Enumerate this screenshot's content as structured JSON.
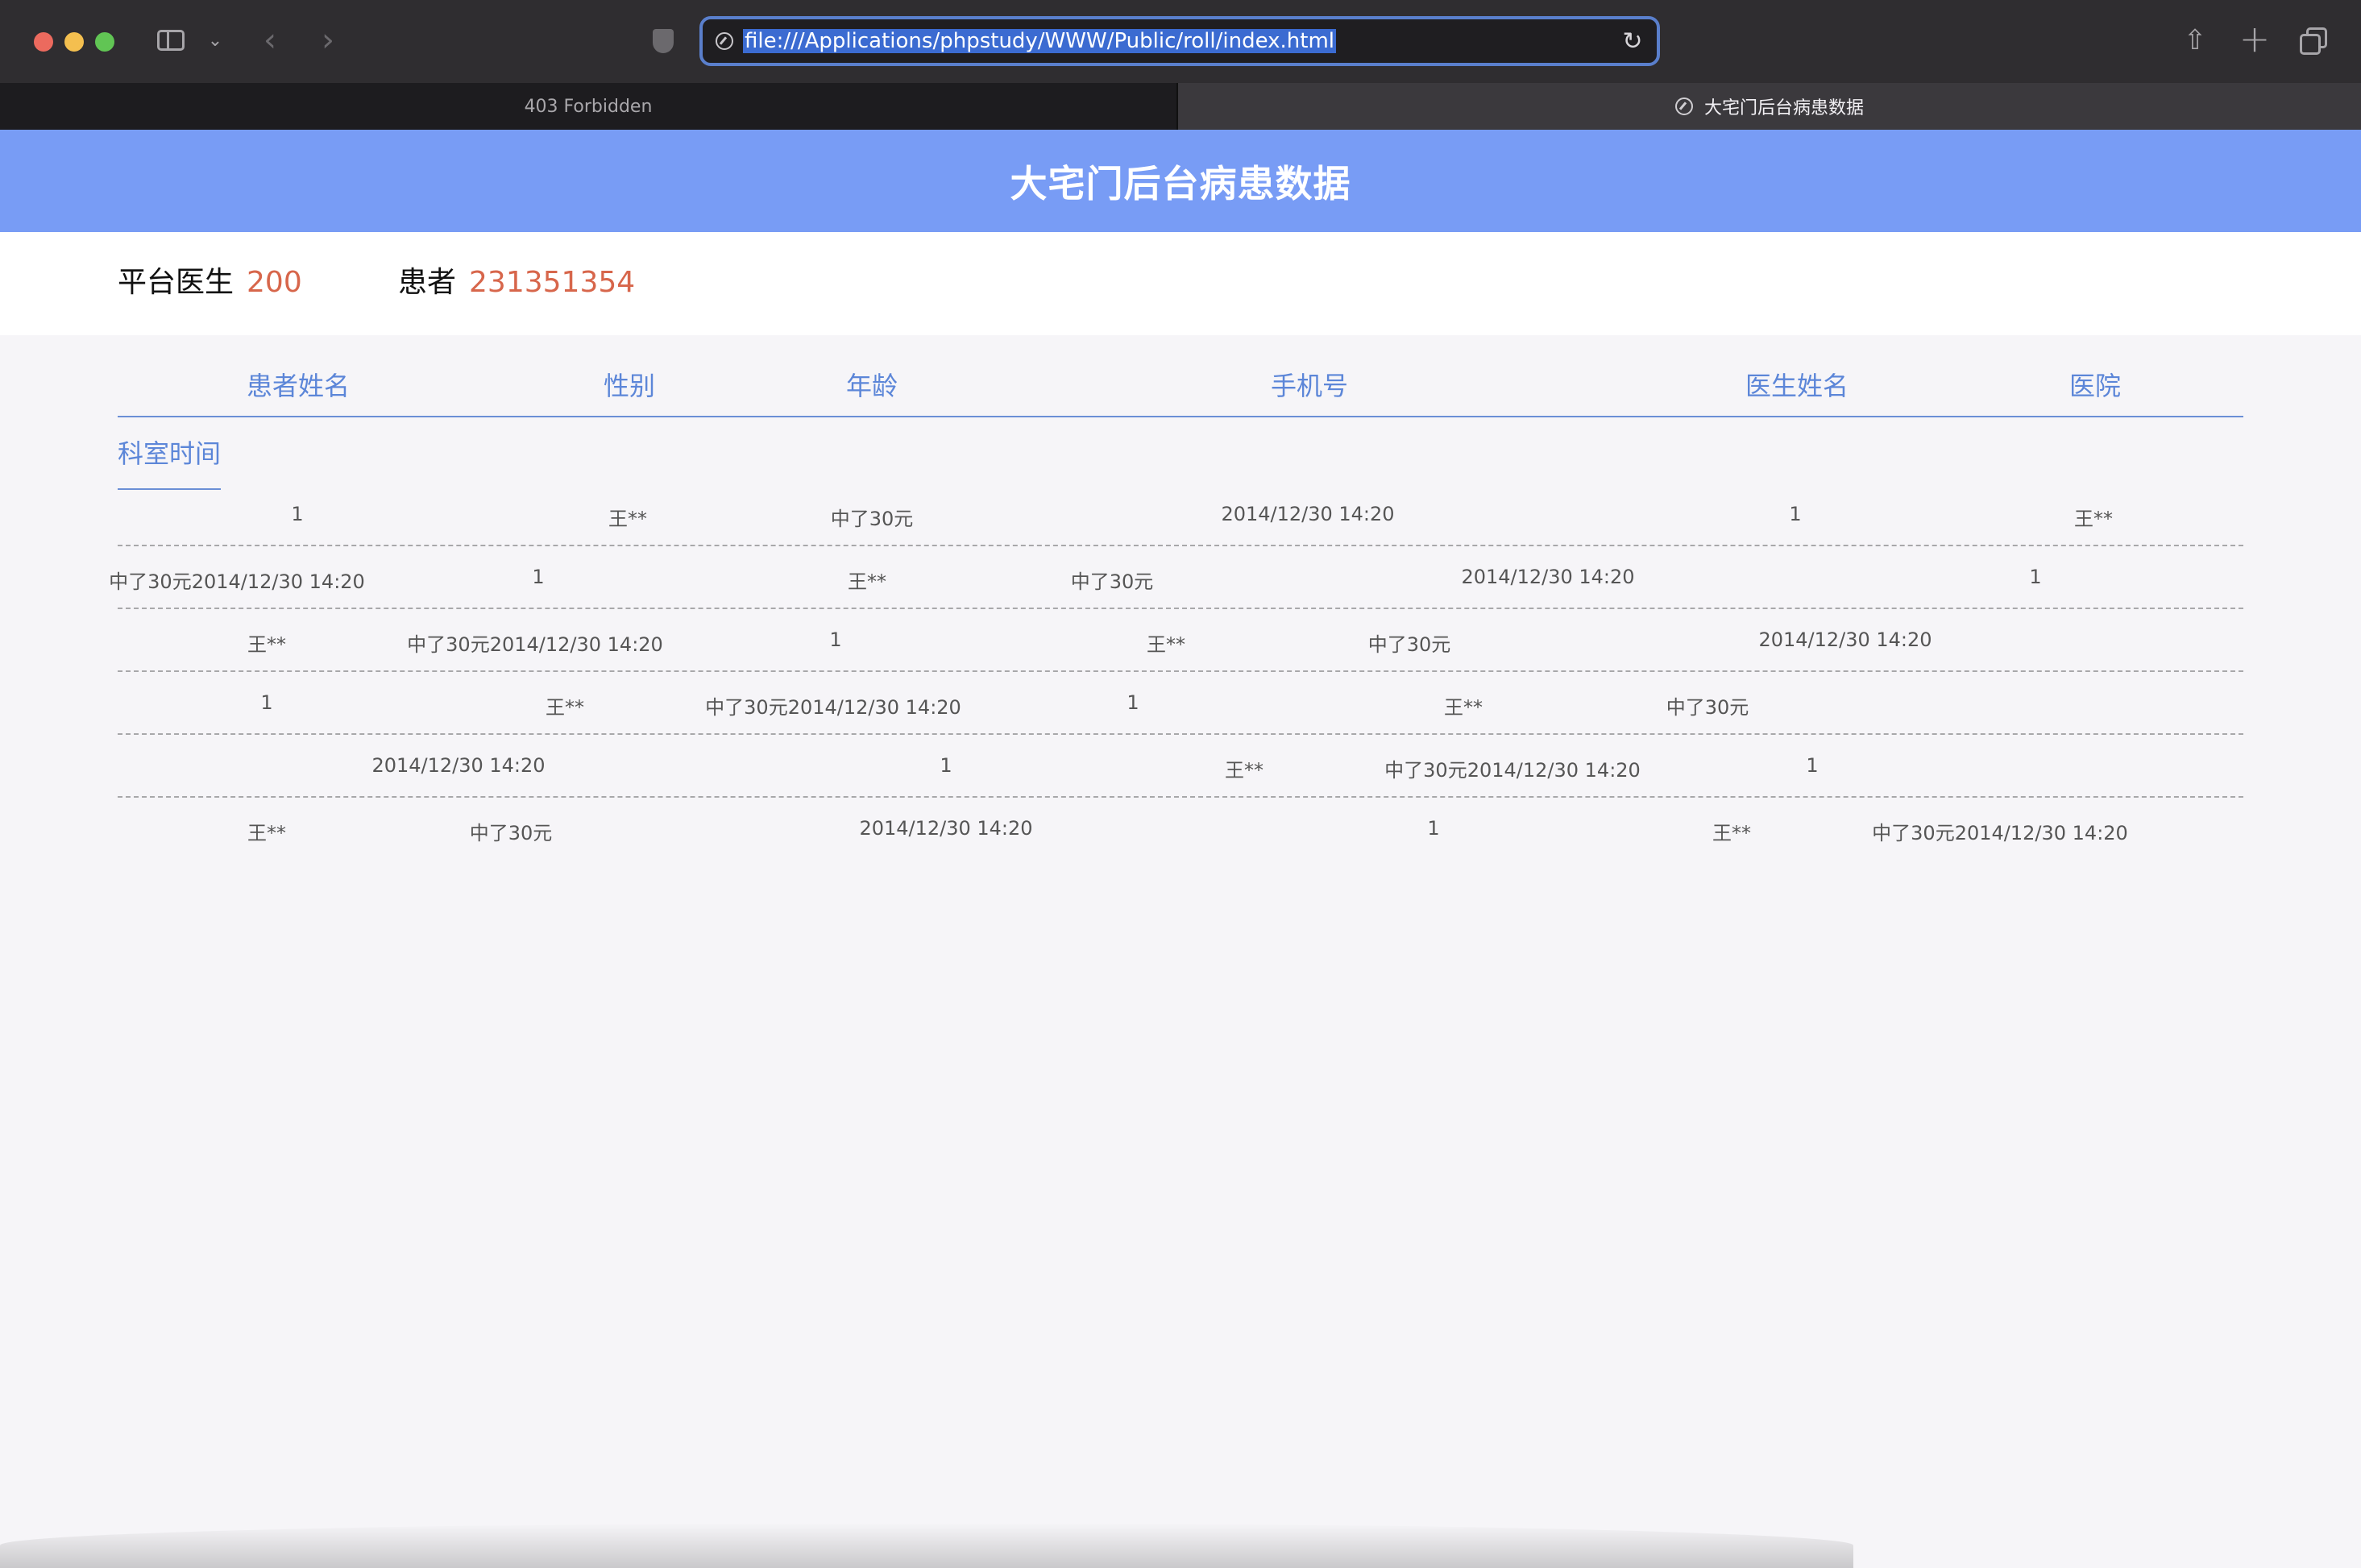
{
  "browser": {
    "url": "file:///Applications/phpstudy/WWW/Public/roll/index.html",
    "tabs": [
      {
        "label": "403 Forbidden",
        "active": false
      },
      {
        "label": "大宅门后台病患数据",
        "active": true
      }
    ]
  },
  "page": {
    "title": "大宅门后台病患数据",
    "stats": {
      "doctors_label": "平台医生",
      "doctors_value": "200",
      "patients_label": "患者",
      "patients_value": "231351354"
    },
    "table": {
      "headers": [
        "患者姓名",
        "性别",
        "年龄",
        "手机号",
        "医生姓名",
        "医院"
      ],
      "second_header": "科室时间",
      "rows": [
        [
          "1",
          "王**",
          "中了30元",
          "2014/12/30 14:20",
          "1",
          "王**"
        ],
        [
          "中了30元2014/12/30 14:20",
          "1",
          "王**",
          "中了30元",
          "2014/12/30 14:20",
          "1"
        ],
        [
          "王**",
          "中了30元2014/12/30 14:20",
          "1",
          "王**",
          "中了30元",
          "2014/12/30 14:20"
        ],
        [
          "1",
          "王**",
          "中了30元2014/12/30 14:20",
          "1",
          "王**",
          "中了30元"
        ],
        [
          "2014/12/30 14:20",
          "1",
          "王**",
          "中了30元2014/12/30 14:20",
          "1"
        ],
        [
          "王**",
          "中了30元",
          "2014/12/30 14:20",
          "1",
          "王**",
          "中了30元2014/12/30 14:20"
        ]
      ]
    }
  },
  "colors": {
    "banner": "#789cf5",
    "accent": "#5c86d8",
    "stat_value": "#d7664b"
  }
}
